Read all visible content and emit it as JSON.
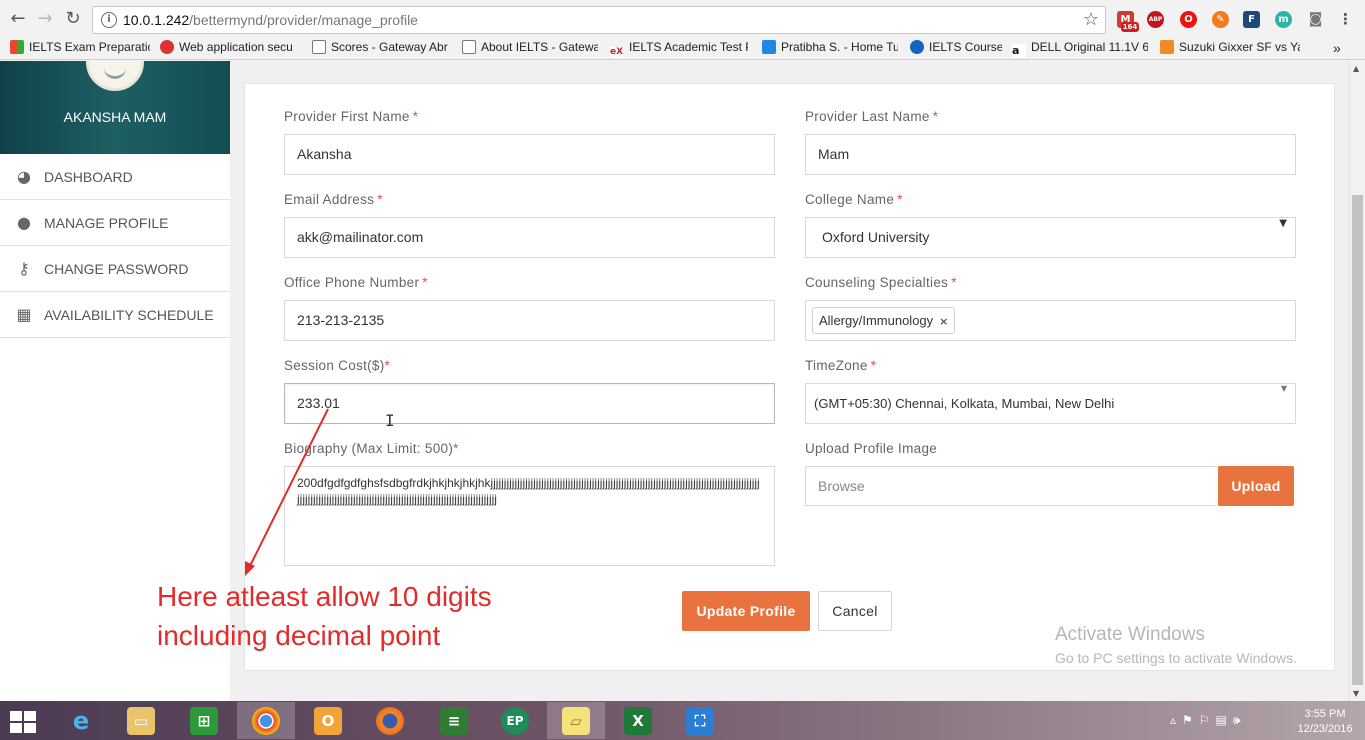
{
  "browser": {
    "url_host": "10.0.1.242",
    "url_path": "/bettermynd/provider/manage_profile",
    "extensions": [
      "164",
      "ABP"
    ],
    "bookmarks": [
      "IELTS Exam Preparatic",
      "Web application secu",
      "Scores - Gateway Abr",
      "About IELTS - Gatewa",
      "IELTS Academic Test P",
      "Pratibha S. - Home Tu",
      "IELTS Course",
      "DELL Original 11.1V 6",
      "Suzuki Gixxer SF vs Ya"
    ],
    "more_bookmarks": "»"
  },
  "sidebar": {
    "user_name": "AKANSHA MAM",
    "items": [
      {
        "label": "DASHBOARD",
        "icon": "dashboard-icon"
      },
      {
        "label": "MANAGE PROFILE",
        "icon": "user-icon"
      },
      {
        "label": "CHANGE PASSWORD",
        "icon": "key-icon"
      },
      {
        "label": "AVAILABILITY SCHEDULE",
        "icon": "calendar-icon"
      }
    ]
  },
  "form": {
    "first_name": {
      "label": "Provider First Name",
      "required": "*",
      "value": "Akansha"
    },
    "last_name": {
      "label": "Provider Last Name",
      "required": "*",
      "value": "Mam"
    },
    "email": {
      "label": "Email Address",
      "required": "*",
      "value": "akk@mailinator.com"
    },
    "college": {
      "label": "College Name",
      "required": "*",
      "value": "Oxford University"
    },
    "phone": {
      "label": "Office Phone Number",
      "required": "*",
      "value": "213-213-2135"
    },
    "specialties": {
      "label": "Counseling Specialties",
      "required": "*",
      "tag": "Allergy/Immunology"
    },
    "session_cost": {
      "label": "Session Cost($)",
      "required": "*",
      "value": "233.01"
    },
    "timezone": {
      "label": "TimeZone",
      "required": "*",
      "value": "(GMT+05:30) Chennai, Kolkata, Mumbai, New Delhi"
    },
    "biography": {
      "label": "Biography (Max Limit: 500)",
      "required": "*",
      "value": "200dfgdfgdfghsfsdbgfrdkjhkjhkjhkjhkjjjjjjjjjjjjjjjjjjjjjjjjjjjjjjjjjjjjjjjjjjjjjjjjjjjjjjjjjjjjjjjjjjjjjjjjjjjjjjjjjjjjjjjjjjjjjjjjjjjjjjjjjjjjjjjjjjjjjjjjjjjjjjjjjjjjjjjjjjjjjjjjjjjjjjjjjjjjjjjjjjjjjjjjjjjjjjjj"
    },
    "upload": {
      "label": "Upload Profile Image",
      "placeholder": "Browse",
      "button": "Upload"
    },
    "update_button": "Update Profile",
    "cancel_button": "Cancel"
  },
  "annotation": {
    "line1": "Here atleast allow 10 digits",
    "line2": "including decimal point",
    "color": "#e32b2b"
  },
  "watermark": {
    "title": "Activate Windows",
    "subtitle": "Go to PC settings to activate Windows."
  },
  "taskbar": {
    "time": "3:55 PM",
    "date": "12/23/2016"
  },
  "colors": {
    "accent": "#e8733f",
    "sidebar_header": "#1e5f63",
    "required": "#d9534f"
  }
}
